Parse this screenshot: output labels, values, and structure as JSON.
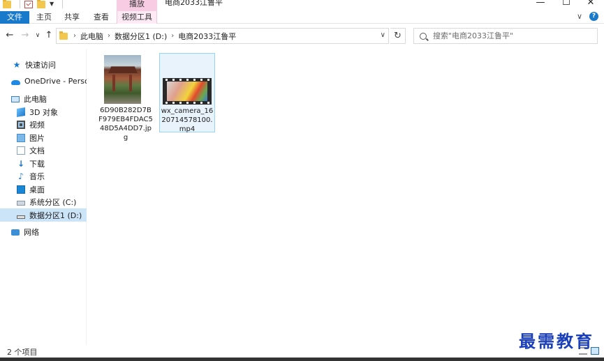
{
  "window": {
    "title": "电商2033江鲁平",
    "context_tab_header": "播放"
  },
  "ribbon": {
    "tabs": [
      {
        "label": "文件"
      },
      {
        "label": "主页"
      },
      {
        "label": "共享"
      },
      {
        "label": "查看"
      },
      {
        "label": "视频工具"
      }
    ]
  },
  "address": {
    "crumbs": [
      "此电脑",
      "数据分区1 (D:)",
      "电商2033江鲁平"
    ]
  },
  "search": {
    "placeholder": "搜索\"电商2033江鲁平\""
  },
  "sidebar": {
    "items": [
      {
        "label": "快速访问",
        "icon": "star-icon"
      },
      {
        "label": "OneDrive - Personal",
        "icon": "cloud-icon"
      },
      {
        "label": "此电脑",
        "icon": "computer-icon"
      },
      {
        "label": "3D 对象",
        "icon": "cube-icon"
      },
      {
        "label": "视频",
        "icon": "video-icon"
      },
      {
        "label": "图片",
        "icon": "picture-icon"
      },
      {
        "label": "文档",
        "icon": "document-icon"
      },
      {
        "label": "下载",
        "icon": "download-icon"
      },
      {
        "label": "音乐",
        "icon": "music-icon"
      },
      {
        "label": "桌面",
        "icon": "desktop-icon"
      },
      {
        "label": "系统分区 (C:)",
        "icon": "drive-c-icon"
      },
      {
        "label": "数据分区1 (D:)",
        "icon": "drive-d-icon"
      },
      {
        "label": "网络",
        "icon": "network-icon"
      }
    ],
    "selected_index": 11
  },
  "files": [
    {
      "name": "6D90B282D7BF979EB4FDAC548D5A4DD7.jpg",
      "type": "image"
    },
    {
      "name": "wx_camera_1620714578100.mp4",
      "type": "video"
    }
  ],
  "status": {
    "item_count": "2 个项目"
  },
  "watermark": {
    "text": "最需教育"
  },
  "colors": {
    "accent": "#1979ca",
    "selection": "#cce4f7",
    "context_tab": "#f8cde3"
  }
}
